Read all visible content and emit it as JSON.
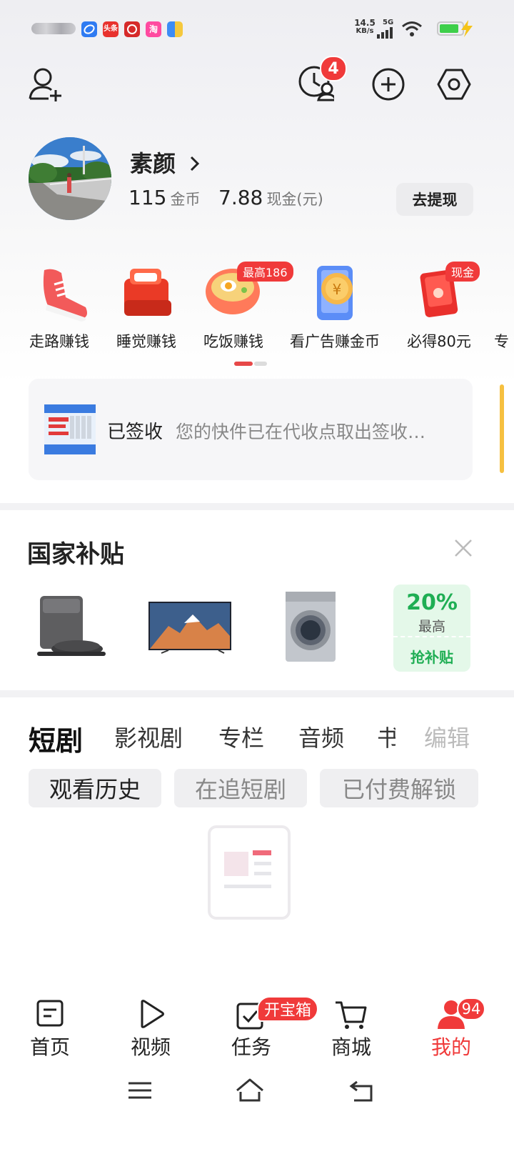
{
  "status_bar": {
    "speed": "14.5",
    "speed_unit": "KB/s",
    "network": "5G",
    "notif_apps": [
      "browser-icon",
      "toutiao-icon",
      "app-red-icon",
      "taobao-icon",
      "files-icon"
    ],
    "toutiao_text": "头条",
    "taobao_text": "淘"
  },
  "header": {
    "message_badge": "4"
  },
  "profile": {
    "name": "素颜",
    "coins": "115",
    "coins_unit": "金币",
    "cash": "7.88",
    "cash_unit": "现金(元)",
    "withdraw_label": "去提现"
  },
  "tasks": [
    {
      "label": "走路赚钱",
      "tag": ""
    },
    {
      "label": "睡觉赚钱",
      "tag": ""
    },
    {
      "label": "吃饭赚钱",
      "tag": "最高186"
    },
    {
      "label": "看广告赚金币",
      "tag": ""
    },
    {
      "label": "必得80元",
      "tag": "现金"
    },
    {
      "label": "专",
      "tag": ""
    }
  ],
  "package": {
    "status": "已签收",
    "message": "您的快件已在代收点取出签收…"
  },
  "subsidy": {
    "title": "国家补贴",
    "products": [
      "robot-vacuum",
      "television",
      "washing-machine"
    ],
    "promo_percent": "20%",
    "promo_sub": "最高",
    "promo_btn": "抢补贴"
  },
  "content_tabs": {
    "tabs": [
      "短剧",
      "影视剧",
      "专栏",
      "音频",
      "书"
    ],
    "edit_label": "编辑",
    "active": "短剧"
  },
  "filter_chips": [
    "观看历史",
    "在追短剧",
    "已付费解锁"
  ],
  "bottom_nav": {
    "items": [
      {
        "label": "首页",
        "badge": ""
      },
      {
        "label": "视频",
        "badge": ""
      },
      {
        "label": "任务",
        "badge": "开宝箱"
      },
      {
        "label": "商城",
        "badge": ""
      },
      {
        "label": "我的",
        "badge": "94"
      }
    ],
    "active": "我的"
  },
  "colors": {
    "accent": "#f03a3a",
    "promo_green": "#1fae54"
  }
}
